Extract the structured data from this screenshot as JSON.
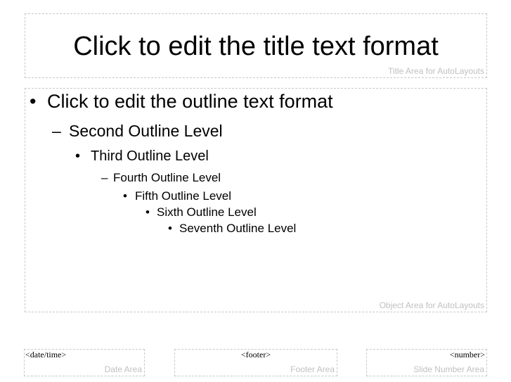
{
  "title_area": {
    "text": "Click to edit the title text format",
    "label": "Title Area for AutoLayouts"
  },
  "object_area": {
    "label": "Object Area for AutoLayouts",
    "outline": [
      {
        "bullet": "•",
        "text": "Click to edit the outline text format"
      },
      {
        "bullet": "–",
        "text": "Second Outline Level"
      },
      {
        "bullet": "•",
        "text": "Third Outline Level"
      },
      {
        "bullet": "–",
        "text": "Fourth Outline Level"
      },
      {
        "bullet": "•",
        "text": "Fifth Outline Level"
      },
      {
        "bullet": "•",
        "text": "Sixth Outline Level"
      },
      {
        "bullet": "•",
        "text": "Seventh Outline Level"
      }
    ]
  },
  "date_area": {
    "field": "<date/time>",
    "label": "Date Area"
  },
  "footer_area": {
    "field": "<footer>",
    "label": "Footer Area"
  },
  "number_area": {
    "field": "<number>",
    "label": "Slide Number Area"
  }
}
